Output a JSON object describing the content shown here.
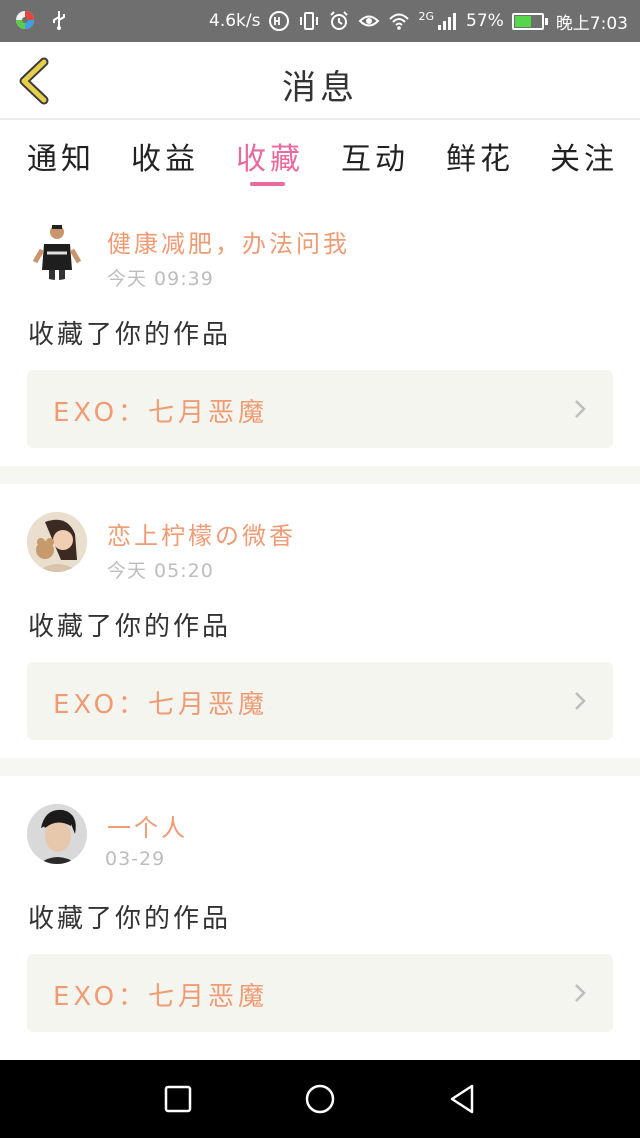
{
  "status_bar": {
    "speed": "4.6k/s",
    "network": "2G",
    "battery": "57%",
    "time": "晚上7:03",
    "battery_level": 0.57
  },
  "header": {
    "title": "消息"
  },
  "tabs": [
    {
      "label": "通知"
    },
    {
      "label": "收益"
    },
    {
      "label": "收藏",
      "active": true
    },
    {
      "label": "互动"
    },
    {
      "label": "鲜花"
    },
    {
      "label": "关注"
    }
  ],
  "messages": [
    {
      "user": "健康减肥，办法问我",
      "time": "今天  09:39",
      "action": "收藏了你的作品",
      "work": "EXO：七月恶魔"
    },
    {
      "user": "恋上柠檬の微香",
      "time": "今天  05:20",
      "action": "收藏了你的作品",
      "work": "EXO：七月恶魔"
    },
    {
      "user": "一个人",
      "time": "03-29",
      "action": "收藏了你的作品",
      "work": "EXO：七月恶魔"
    }
  ],
  "colors": {
    "accent": "#e86a9e",
    "name": "#ef9b74",
    "back_icon": "#e6cf4a"
  }
}
